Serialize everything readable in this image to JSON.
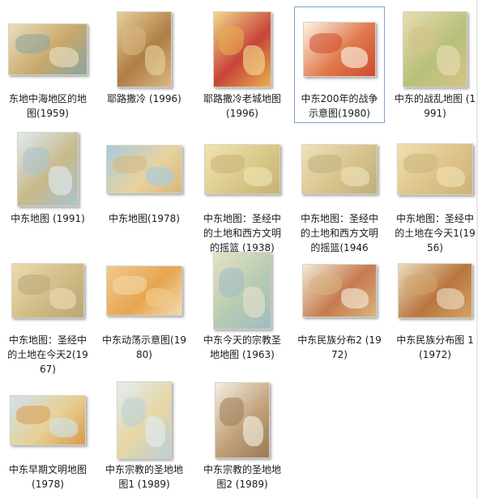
{
  "items": [
    {
      "label": "东地中海地区的地图(1959)",
      "colors": [
        "#e9dfc0",
        "#c9a86a",
        "#8aa6a0"
      ]
    },
    {
      "label": "耶路撒冷 (1996)",
      "colors": [
        "#e6cf9a",
        "#b07d45",
        "#d9b884"
      ]
    },
    {
      "label": "耶路撒冷老城地图 (1996)",
      "colors": [
        "#f2d98a",
        "#c8443a",
        "#e7b04d"
      ]
    },
    {
      "label": "中东200年的战争示意图(1980)",
      "colors": [
        "#fbf3e4",
        "#e07a4e",
        "#d04a2e"
      ]
    },
    {
      "label": "中东的战乱地图 (1991)",
      "colors": [
        "#e7ddb2",
        "#b8c07a",
        "#d6c388"
      ]
    },
    {
      "label": "中东地图 (1991)",
      "colors": [
        "#dfe9ee",
        "#c7b98a",
        "#a9c3cf"
      ]
    },
    {
      "label": "中东地图(1978)",
      "colors": [
        "#a8cbe0",
        "#e7d3a0",
        "#d9b67a"
      ]
    },
    {
      "label": "中东地图：圣经中的土地和西方文明的摇篮 (1938)",
      "colors": [
        "#f0e4b0",
        "#d9c98a",
        "#c7b176"
      ]
    },
    {
      "label": "中东地图：圣经中的土地和西方文明的摇篮(1946",
      "colors": [
        "#eee2b9",
        "#d8c38d",
        "#bfae7e"
      ]
    },
    {
      "label": "中东地图：圣经中的土地在今天1(1956)",
      "colors": [
        "#efe0b0",
        "#dcc38a",
        "#cdb27a"
      ]
    },
    {
      "label": "中东地图：圣经中的土地在今天2(1967)",
      "colors": [
        "#ebdcb0",
        "#d1bb86",
        "#b9a676"
      ]
    },
    {
      "label": "中东动荡示意图(1980)",
      "colors": [
        "#f3c98a",
        "#e6a550",
        "#f0dcb0"
      ]
    },
    {
      "label": "中东今天的宗教圣地地图 (1963)",
      "colors": [
        "#e6e1c8",
        "#b5cbb0",
        "#9fbcc8"
      ]
    },
    {
      "label": "中东民族分布2 (1972)",
      "colors": [
        "#f2ead8",
        "#c67a4e",
        "#d9b380"
      ]
    },
    {
      "label": "中东民族分布图 1 (1972)",
      "colors": [
        "#eaddc0",
        "#b9753e",
        "#d3a468"
      ]
    },
    {
      "label": "中东早期文明地图 (1978)",
      "colors": [
        "#cfe3ec",
        "#e8cf92",
        "#d89a4c"
      ]
    },
    {
      "label": "中东宗教的圣地地图1 (1989)",
      "colors": [
        "#e2edf0",
        "#e6d6a4",
        "#b9cfd9"
      ]
    },
    {
      "label": "中东宗教的圣地地图2 (1989)",
      "colors": [
        "#f3eee3",
        "#c2a27a",
        "#9a7a55"
      ]
    }
  ]
}
